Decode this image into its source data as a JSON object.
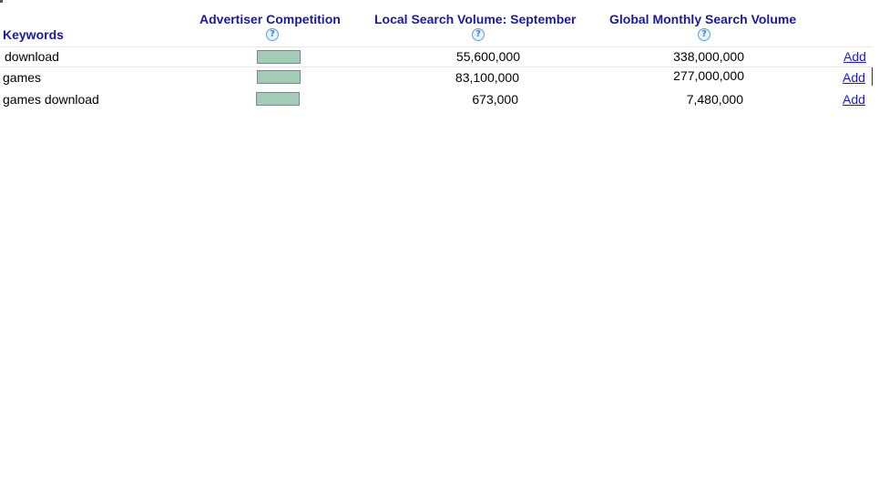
{
  "table": {
    "headers": {
      "keywords": "Keywords",
      "competition": "Advertiser Competition",
      "local_volume": "Local Search Volume: September",
      "global_volume": "Global Monthly Search Volume",
      "help_glyph": "?"
    },
    "rows": [
      {
        "keyword": "download",
        "competition_level": 1.0,
        "local_volume": "55,600,000",
        "global_volume": "338,000,000",
        "action": "Add"
      },
      {
        "keyword": "games",
        "competition_level": 1.0,
        "local_volume": "83,100,000",
        "global_volume": "277,000,000",
        "action": "Add"
      },
      {
        "keyword": "games download",
        "competition_level": 1.0,
        "local_volume": "673,000",
        "global_volume": "7,480,000",
        "action": "Add"
      }
    ]
  },
  "colors": {
    "header_text": "#1a1a9c",
    "competition_bar": "#a3ccb8",
    "link": "#1a1acc"
  },
  "icons": {
    "help": "help-icon"
  }
}
